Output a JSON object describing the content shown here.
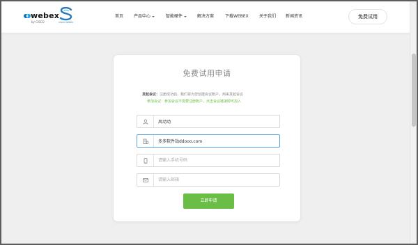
{
  "header": {
    "logo_webex": "webex",
    "logo_webex_by": "by CISCO",
    "logo_s_sub": "CISCO WEBEX",
    "nav": [
      {
        "label": "首页",
        "has_dropdown": false
      },
      {
        "label": "产品中心",
        "has_dropdown": true
      },
      {
        "label": "智能硬件",
        "has_dropdown": true
      },
      {
        "label": "解决方案",
        "has_dropdown": false
      },
      {
        "label": "下载WEBEX",
        "has_dropdown": false
      },
      {
        "label": "关于我们",
        "has_dropdown": false
      },
      {
        "label": "新闻资讯",
        "has_dropdown": false
      }
    ],
    "trial_button": "免费试用"
  },
  "form": {
    "title": "免费试用申请",
    "note_label": "发起会议：",
    "note_text": "注册成功后，我们将为您创建会议账户，用来发起会议",
    "note_join": "参加会议：参加会议不需要注册账户，点击会议链接即可加入",
    "name": {
      "value": "风动动",
      "placeholder": "",
      "icon": "user-icon"
    },
    "company": {
      "value": "多多软件站ddooo.com",
      "placeholder": "",
      "icon": "building-icon"
    },
    "phone": {
      "value": "",
      "placeholder": "请输入手机号码",
      "icon": "phone-icon"
    },
    "email": {
      "value": "",
      "placeholder": "请输入邮箱",
      "icon": "mail-icon"
    },
    "submit": "立即申请"
  },
  "colors": {
    "accent_green": "#6abe45",
    "focus_blue": "#5aa4de",
    "webex_blue": "#2a7ab8"
  }
}
